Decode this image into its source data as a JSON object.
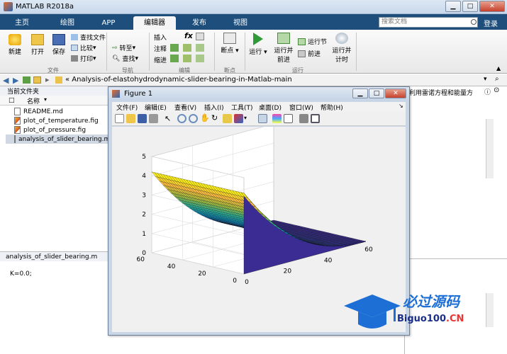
{
  "app": {
    "title": "MATLAB R2018a"
  },
  "tabs": [
    "主页",
    "绘图",
    "APP",
    "编辑器",
    "发布",
    "视图"
  ],
  "active_tab": 3,
  "search": {
    "placeholder": "搜索文档"
  },
  "login": "登录",
  "ribbon": {
    "new": "新建",
    "open": "打开",
    "save": "保存",
    "find_files": "查找文件",
    "compare": "比较",
    "print": "打印",
    "goto": "转至",
    "find": "查找",
    "insert": "插入",
    "fx": "fx",
    "comment": "注释",
    "indent": "缩进",
    "breakpoints": "断点",
    "run": "运行",
    "run_advance_1": "运行并",
    "run_advance_2": "前进",
    "run_section": "运行节",
    "advance": "前进",
    "run_time_1": "运行并",
    "run_time_2": "计时",
    "groups": {
      "file": "文件",
      "navigate": "导航",
      "edit": "编辑",
      "breakpoints": "断点",
      "run": "运行"
    }
  },
  "address": {
    "path": "« Analysis-of-elastohydrodynamic-slider-bearing-in-Matlab-main"
  },
  "current_folder": {
    "title": "当前文件夹",
    "column": "名称",
    "files": [
      {
        "name": "README.md",
        "type": "md"
      },
      {
        "name": "plot_of_temperature.fig",
        "type": "fig"
      },
      {
        "name": "plot_of_pressure.fig",
        "type": "fig"
      },
      {
        "name": "analysis_of_slider_bearing.m",
        "type": "m"
      }
    ]
  },
  "details": {
    "title": "analysis_of_slider_bearing.m",
    "text": "K=0.0;"
  },
  "right_panel": {
    "header": "利用雷诺方程和能量方"
  },
  "figure": {
    "title": "Figure 1",
    "menu": [
      "文件(F)",
      "编辑(E)",
      "查看(V)",
      "插入(I)",
      "工具(T)",
      "桌面(D)",
      "窗口(W)",
      "帮助(H)"
    ]
  },
  "chart_data": {
    "type": "surface",
    "z_ticks": [
      0,
      1,
      2,
      3,
      4,
      5
    ],
    "x_ticks": [
      0,
      20,
      40,
      60
    ],
    "y_ticks": [
      0,
      20,
      40,
      60
    ],
    "zlim": [
      0,
      5
    ],
    "xlim": [
      0,
      60
    ],
    "ylim": [
      0,
      60
    ],
    "colormap": "parula"
  },
  "watermark": {
    "line1": "必过源码",
    "line2": "Biguo100",
    "line2_suffix": ".CN"
  }
}
